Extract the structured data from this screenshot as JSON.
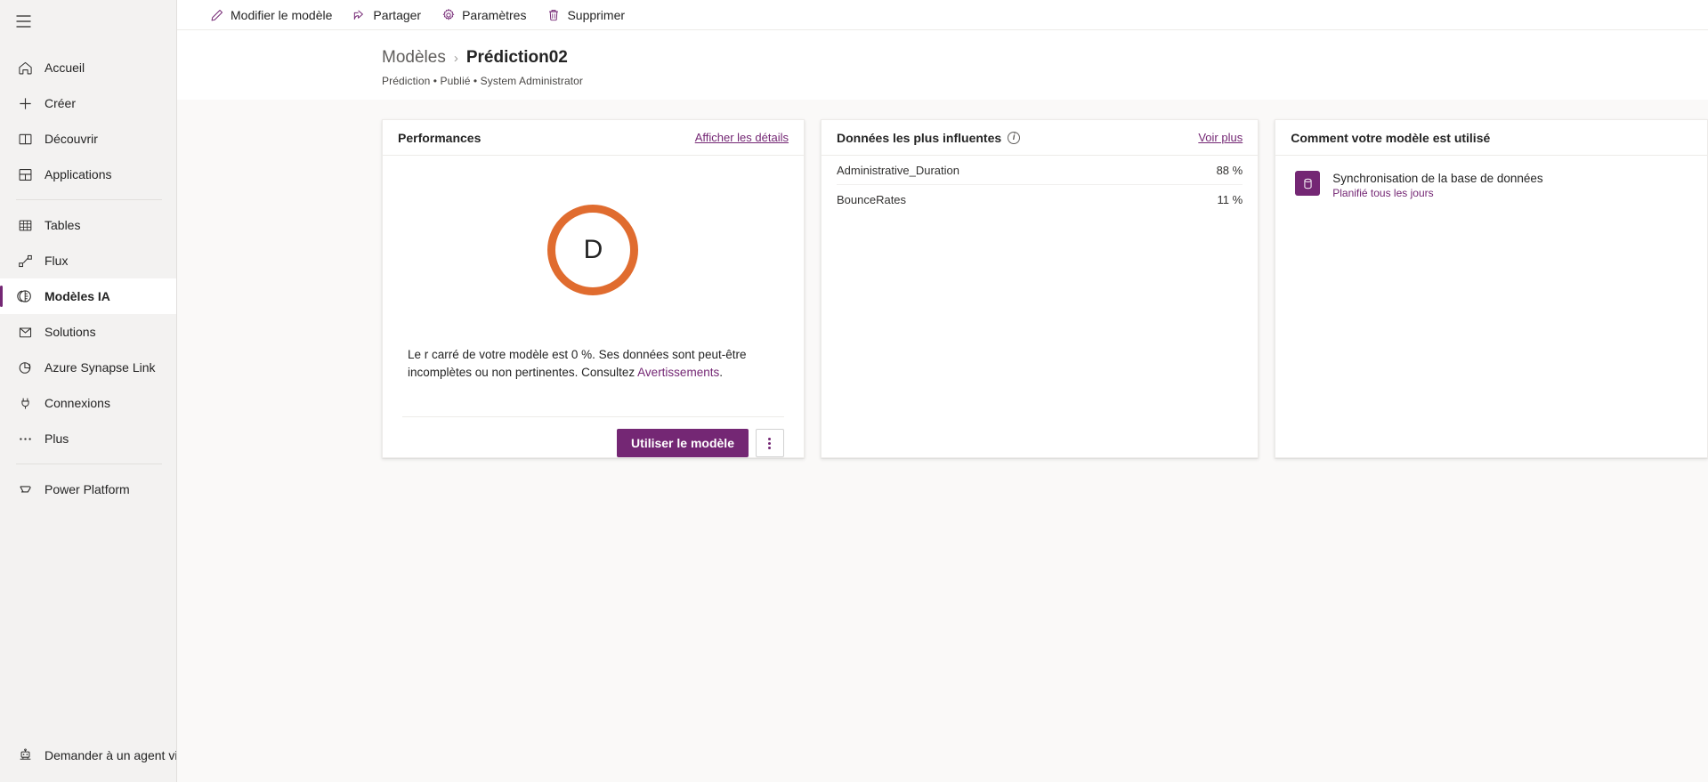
{
  "sidebar": {
    "menu_icon": "hamburger-icon",
    "items": [
      {
        "label": "Accueil",
        "icon": "home-icon",
        "active": false
      },
      {
        "label": "Créer",
        "icon": "plus-icon",
        "active": false
      },
      {
        "label": "Découvrir",
        "icon": "book-icon",
        "active": false
      },
      {
        "label": "Applications",
        "icon": "apps-grid-icon",
        "active": false
      },
      {
        "label": "Tables",
        "icon": "table-icon",
        "active": false
      },
      {
        "label": "Flux",
        "icon": "flow-icon",
        "active": false
      },
      {
        "label": "Modèles IA",
        "icon": "ai-brain-icon",
        "active": true
      },
      {
        "label": "Solutions",
        "icon": "solutions-icon",
        "active": false
      },
      {
        "label": "Azure Synapse Link",
        "icon": "synapse-icon",
        "active": false
      },
      {
        "label": "Connexions",
        "icon": "plug-icon",
        "active": false
      },
      {
        "label": "Plus",
        "icon": "ellipsis-icon",
        "active": false
      },
      {
        "label": "Power Platform",
        "icon": "power-platform-icon",
        "active": false
      }
    ],
    "bottom_item": {
      "label": "Demander à un agent virt",
      "icon": "virtual-agent-icon"
    }
  },
  "commandbar": {
    "buttons": [
      {
        "label": "Modifier le modèle",
        "icon": "pencil-icon"
      },
      {
        "label": "Partager",
        "icon": "share-icon"
      },
      {
        "label": "Paramètres",
        "icon": "gear-icon"
      },
      {
        "label": "Supprimer",
        "icon": "trash-icon"
      }
    ]
  },
  "header": {
    "breadcrumb_parent": "Modèles",
    "breadcrumb_separator": "›",
    "breadcrumb_current": "Prédiction02",
    "subtitle": "Prédiction • Publié • System Administrator"
  },
  "cards": {
    "performance": {
      "title": "Performances",
      "details_link": "Afficher les détails",
      "grade": "D",
      "grade_color": "#E06C2F",
      "description_before": "Le r carré de votre modèle est 0 %. Ses données sont peut-être incomplètes ou non pertinentes. Consultez ",
      "description_link": "Avertissements",
      "description_after": ".",
      "primary_button": "Utiliser le modèle",
      "overflow_button": "more-options"
    },
    "influence": {
      "title": "Données les plus influentes",
      "info_icon": "info-icon",
      "see_more_link": "Voir plus",
      "rows": [
        {
          "name": "Administrative_Duration",
          "percent": "88 %"
        },
        {
          "name": "BounceRates",
          "percent": "11 %"
        }
      ]
    },
    "usage": {
      "title": "Comment votre modèle est utilisé",
      "items": [
        {
          "icon": "database-icon",
          "title": "Synchronisation de la base de données",
          "subtitle": "Planifié tous les jours"
        }
      ]
    }
  },
  "theme": {
    "accent": "#742774",
    "sidebar_bg": "#f3f2f1",
    "page_bg": "#faf9f8",
    "grade_orange": "#E06C2F"
  }
}
